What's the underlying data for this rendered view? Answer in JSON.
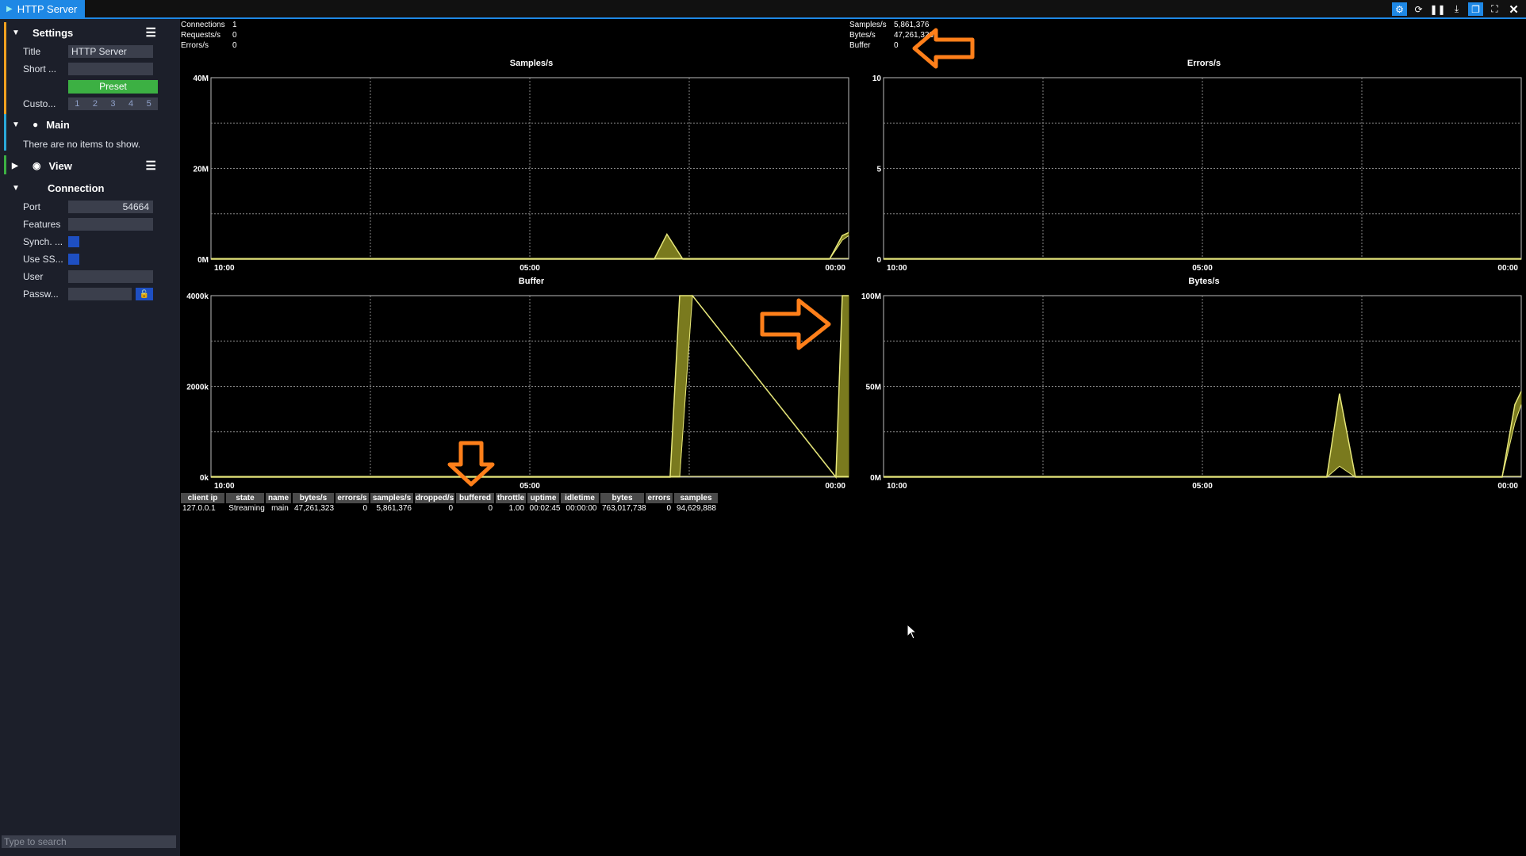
{
  "window": {
    "tab_title": "HTTP Server",
    "toolbar_icons": [
      "gear-icon",
      "refresh-icon",
      "pause-icon",
      "download-icon",
      "restore-icon",
      "fullscreen-icon",
      "close-icon"
    ]
  },
  "sidebar": {
    "settings": {
      "title": "Settings",
      "title_label": "Title",
      "title_value": "HTTP Server",
      "short_label": "Short ...",
      "short_value": "",
      "preset_label": "Preset",
      "custom_label": "Custo...",
      "custom_numbers": [
        "1",
        "2",
        "3",
        "4",
        "5"
      ]
    },
    "main": {
      "title": "Main",
      "empty_message": "There are no items to show."
    },
    "view": {
      "title": "View"
    },
    "connection": {
      "title": "Connection",
      "port_label": "Port",
      "port_value": "54664",
      "features_label": "Features",
      "features_value": "",
      "synch_label": "Synch. ...",
      "usessl_label": "Use SS...",
      "user_label": "User",
      "user_value": "",
      "password_label": "Passw...",
      "password_value": ""
    },
    "search_placeholder": "Type to search"
  },
  "stats_left": [
    {
      "label": "Connections",
      "value": "1"
    },
    {
      "label": "Requests/s",
      "value": "0"
    },
    {
      "label": "Errors/s",
      "value": "0"
    }
  ],
  "stats_right": [
    {
      "label": "Samples/s",
      "value": "5,861,376"
    },
    {
      "label": "Bytes/s",
      "value": "47,261,323"
    },
    {
      "label": "Buffer",
      "value": "0"
    }
  ],
  "chart_data": [
    {
      "type": "area",
      "title": "Samples/s",
      "yticks": [
        "40M",
        "20M",
        "0M"
      ],
      "ylim": [
        0,
        40000000
      ],
      "xticks": [
        "10:00",
        "05:00",
        "00:00"
      ],
      "xlim": [
        -10,
        0
      ],
      "x": [
        -10,
        -3.05,
        -2.85,
        -2.6,
        -0.3,
        -0.1,
        0
      ],
      "values": [
        0,
        0,
        5500000,
        0,
        0,
        5200000,
        5861376
      ],
      "lower": [
        0,
        0,
        0,
        0,
        0,
        4200000,
        5200000
      ],
      "grid": true
    },
    {
      "type": "area",
      "title": "Errors/s",
      "yticks": [
        "10",
        "5",
        "0"
      ],
      "ylim": [
        0,
        10
      ],
      "xticks": [
        "10:00",
        "05:00",
        "00:00"
      ],
      "xlim": [
        -10,
        0
      ],
      "x": [
        -10,
        0
      ],
      "values": [
        0,
        0
      ],
      "lower": [
        0,
        0
      ],
      "grid": true
    },
    {
      "type": "area",
      "title": "Buffer",
      "yticks": [
        "4000k",
        "2000k",
        "0k"
      ],
      "ylim": [
        0,
        4000000
      ],
      "xticks": [
        "10:00",
        "05:00",
        "00:00"
      ],
      "xlim": [
        -10,
        0
      ],
      "x": [
        -10,
        -2.8,
        -2.65,
        -2.45,
        -0.2,
        -0.1,
        0
      ],
      "values": [
        0,
        0,
        4000000,
        4000000,
        0,
        4000000,
        4000000
      ],
      "lower": [
        0,
        0,
        0,
        4000000,
        0,
        0,
        0
      ],
      "grid": true
    },
    {
      "type": "area",
      "title": "Bytes/s",
      "yticks": [
        "100M",
        "50M",
        "0M"
      ],
      "ylim": [
        0,
        100000000
      ],
      "xticks": [
        "10:00",
        "05:00",
        "00:00"
      ],
      "xlim": [
        -10,
        0
      ],
      "x": [
        -10,
        -3.05,
        -2.85,
        -2.6,
        -0.3,
        -0.1,
        0
      ],
      "values": [
        0,
        0,
        46000000,
        0,
        0,
        40000000,
        47261323
      ],
      "lower": [
        0,
        0,
        6000000,
        0,
        0,
        30000000,
        40000000
      ],
      "grid": true
    }
  ],
  "table": {
    "columns": [
      "client ip",
      "state",
      "name",
      "bytes/s",
      "errors/s",
      "samples/s",
      "dropped/s",
      "buffered",
      "throttle",
      "uptime",
      "idletime",
      "bytes",
      "errors",
      "samples"
    ],
    "rows": [
      [
        "127.0.0.1",
        "Streaming",
        "main",
        "47,261,323",
        "0",
        "5,861,376",
        "0",
        "0",
        "1.00",
        "00:02:45",
        "00:00:00",
        "763,017,738",
        "0",
        "94,629,888"
      ]
    ]
  },
  "colors": {
    "accent_blue": "#1e88e5",
    "chart_fill": "#7a7a1e",
    "chart_line": "#e6e67a",
    "annotation_arrow": "#ff7f1a",
    "settings_accent": "#f0a020",
    "main_accent": "#2aa8d8",
    "view_accent": "#3cb043"
  }
}
